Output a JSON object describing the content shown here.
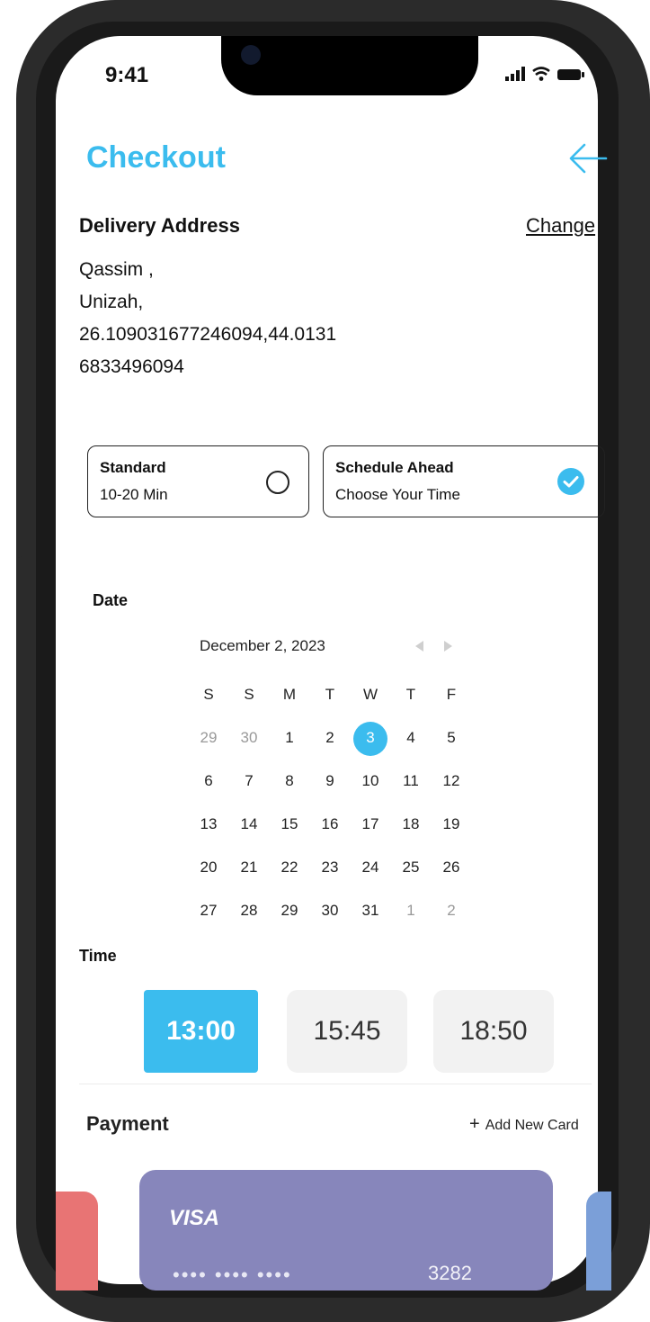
{
  "status": {
    "time": "9:41"
  },
  "header": {
    "title": "Checkout"
  },
  "address": {
    "label": "Delivery Address",
    "change": "Change",
    "line1": "Qassim ,",
    "line2": "Unizah,",
    "line3": "26.109031677246094,44.0131",
    "line4": "6833496094"
  },
  "delivery_options": [
    {
      "title": "Standard",
      "subtitle": "10-20 Min",
      "selected": false
    },
    {
      "title": "Schedule Ahead",
      "subtitle": "Choose Your Time",
      "selected": true
    }
  ],
  "date": {
    "label": "Date",
    "month": "December 2, 2023",
    "weekdays": [
      "S",
      "S",
      "M",
      "T",
      "W",
      "T",
      "F"
    ],
    "weeks": [
      [
        "29",
        "30",
        "1",
        "2",
        "3",
        "4",
        "5"
      ],
      [
        "6",
        "7",
        "8",
        "9",
        "10",
        "11",
        "12"
      ],
      [
        "13",
        "14",
        "15",
        "16",
        "17",
        "18",
        "19"
      ],
      [
        "20",
        "21",
        "22",
        "23",
        "24",
        "25",
        "26"
      ],
      [
        "27",
        "28",
        "29",
        "30",
        "31",
        "1",
        "2"
      ]
    ],
    "selected_day": "3"
  },
  "time": {
    "label": "Time",
    "slots": [
      "13:00",
      "15:45",
      "18:50"
    ],
    "selected": "13:00"
  },
  "payment": {
    "label": "Payment",
    "add": "Add New Card",
    "card_brand": "VISA",
    "card_mask": "•••• •••• ••••",
    "card_last": "3282"
  },
  "colors": {
    "accent": "#3bbcee",
    "card_main": "#8786bb",
    "card_left": "#e87474",
    "card_right": "#7b9fd8"
  }
}
